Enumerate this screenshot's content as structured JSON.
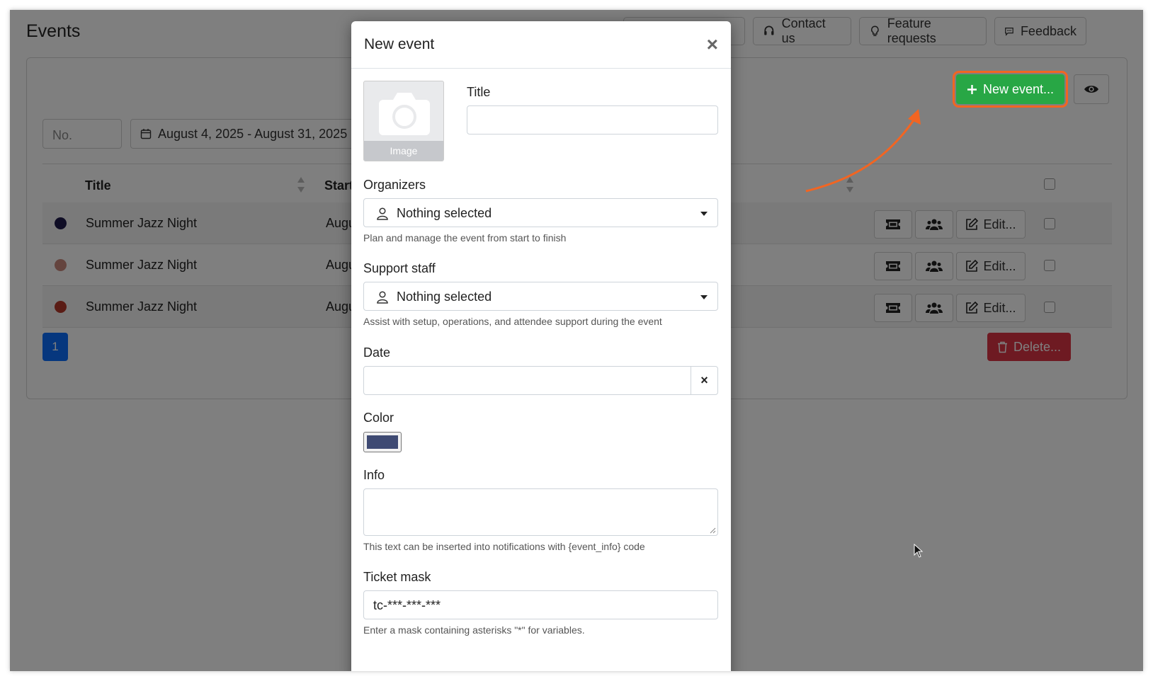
{
  "page": {
    "title": "Events"
  },
  "top_buttons": {
    "contact": "Contact us",
    "features": "Feature requests",
    "feedback": "Feedback"
  },
  "toolbar": {
    "new_event": "New event..."
  },
  "filters": {
    "number_placeholder": "No.",
    "date_range": "August 4, 2025 - August 31, 2025"
  },
  "table": {
    "headers": {
      "title": "Title",
      "start": "Start"
    },
    "rows": [
      {
        "color": "#1e1b4b",
        "title": "Summer Jazz Night",
        "start": "Augu"
      },
      {
        "color": "#c9897d",
        "title": "Summer Jazz Night",
        "start": "Augu"
      },
      {
        "color": "#b5382a",
        "title": "Summer Jazz Night",
        "start": "Augu"
      }
    ],
    "edit_label": "Edit..."
  },
  "pagination": {
    "current": "1"
  },
  "actions": {
    "delete": "Delete..."
  },
  "modal": {
    "title": "New event",
    "image_label": "Image",
    "title_label": "Title",
    "organizers_label": "Organizers",
    "organizers_value": "Nothing selected",
    "organizers_hint": "Plan and manage the event from start to finish",
    "support_label": "Support staff",
    "support_value": "Nothing selected",
    "support_hint": "Assist with setup, operations, and attendee support during the event",
    "date_label": "Date",
    "color_label": "Color",
    "color_value": "#3f4a73",
    "info_label": "Info",
    "info_hint": "This text can be inserted into notifications with {event_info} code",
    "ticket_label": "Ticket mask",
    "ticket_value": "tc-***-***-***",
    "ticket_hint": "Enter a mask containing asterisks \"*\" for variables."
  }
}
